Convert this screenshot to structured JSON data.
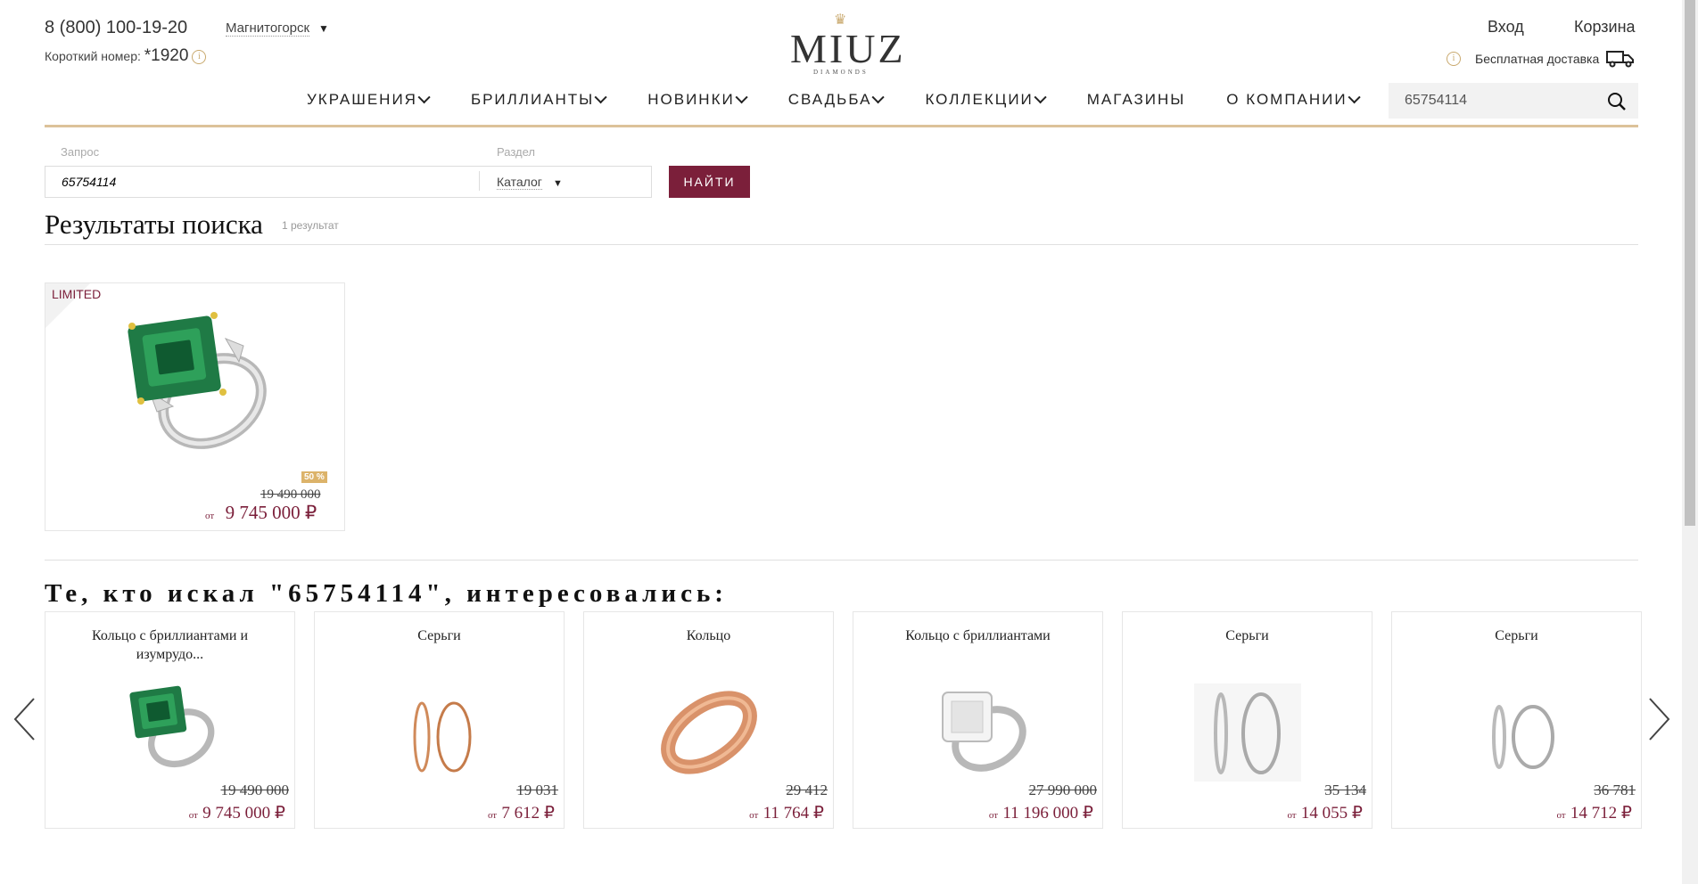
{
  "header": {
    "phone": "8 (800) 100-19-20",
    "city": "Магнитогорск",
    "short_label": "Короткий номер:",
    "short_number": "*1920",
    "logo": "MIUZ",
    "logo_sub": "DIAMONDS",
    "login": "Вход",
    "cart": "Корзина",
    "delivery": "Бесплатная доставка",
    "search_value": "65754114"
  },
  "nav": [
    {
      "label": "УКРАШЕНИЯ",
      "dropdown": true
    },
    {
      "label": "БРИЛЛИАНТЫ",
      "dropdown": true
    },
    {
      "label": "НОВИНКИ",
      "dropdown": true
    },
    {
      "label": "СВАДЬБА",
      "dropdown": true
    },
    {
      "label": "КОЛЛЕКЦИИ",
      "dropdown": true
    },
    {
      "label": "МАГАЗИНЫ",
      "dropdown": false
    },
    {
      "label": "О КОМПАНИИ",
      "dropdown": true
    }
  ],
  "search_form": {
    "query_label": "Запрос",
    "query_value": "65754114",
    "section_label": "Раздел",
    "section_value": "Каталог",
    "button": "НАЙТИ"
  },
  "results": {
    "title": "Результаты поиска",
    "count": "1 результат",
    "item": {
      "badge": "LIMITED",
      "discount": "50 %",
      "old_price": "19 490 000",
      "from": "от",
      "price": "9 745 000 ₽"
    }
  },
  "interested": {
    "title": "Те, кто искал \"65754114\", интересовались:",
    "items": [
      {
        "title": "Кольцо с бриллиантами и изумрудо...",
        "old_price": "19 490 000",
        "from": "от",
        "price": "9 745 000 ₽",
        "icon": "emerald-ring"
      },
      {
        "title": "Серьги",
        "old_price": "19 031",
        "from": "от",
        "price": "7 612 ₽",
        "icon": "gold-hoop-earrings"
      },
      {
        "title": "Кольцо",
        "old_price": "29 412",
        "from": "от",
        "price": "11 764 ₽",
        "icon": "gold-band-ring"
      },
      {
        "title": "Кольцо с бриллиантами",
        "old_price": "27 990 000",
        "from": "от",
        "price": "11 196 000 ₽",
        "icon": "diamond-ring"
      },
      {
        "title": "Серьги",
        "old_price": "35 134",
        "from": "от",
        "price": "14 055 ₽",
        "icon": "silver-hoop-earrings"
      },
      {
        "title": "Серьги",
        "old_price": "36 781",
        "from": "от",
        "price": "14 712 ₽",
        "icon": "silver-hoop-earrings-2"
      }
    ]
  },
  "colors": {
    "accent": "#7b1f3a",
    "gold": "#dcc29a"
  }
}
